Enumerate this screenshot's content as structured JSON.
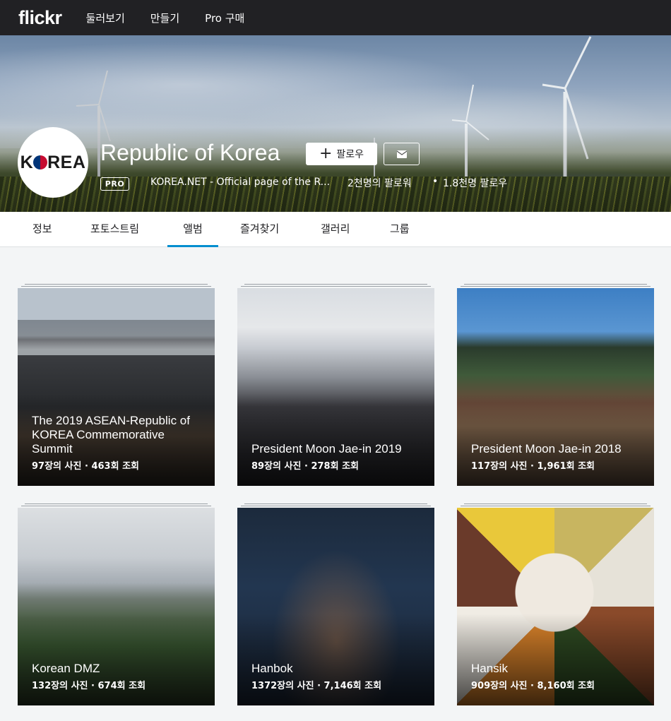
{
  "topnav": {
    "logo": "flickr",
    "links": [
      "둘러보기",
      "만들기",
      "Pro 구매"
    ]
  },
  "profile": {
    "avatar_text_left": "K",
    "avatar_text_right": "REA",
    "name": "Republic of Korea",
    "follow_label": "팔로우",
    "pro_badge": "PRO",
    "description": "KOREA.NET - Official page of the R...",
    "followers": "2천명의 팔로워",
    "dot": "•",
    "following": "1.8천명 팔로우"
  },
  "subnav": {
    "tabs": [
      "정보",
      "포토스트림",
      "앨범",
      "즐겨찾기",
      "갤러리",
      "그룹"
    ],
    "active": "앨범"
  },
  "albums": [
    {
      "title": "The 2019 ASEAN-Republic of KOREA Commemorative Summit",
      "meta": "97장의 사진 · 463회 조회"
    },
    {
      "title": "President Moon Jae-in 2019",
      "meta": "89장의 사진 · 278회 조회"
    },
    {
      "title": "President Moon Jae-in 2018",
      "meta": "117장의 사진 · 1,961회 조회"
    },
    {
      "title": "Korean DMZ",
      "meta": "132장의 사진 · 674회 조회"
    },
    {
      "title": "Hanbok",
      "meta": "1372장의 사진 · 7,146회 조회"
    },
    {
      "title": "Hansik",
      "meta": "909장의 사진 · 8,160회 조회"
    }
  ]
}
